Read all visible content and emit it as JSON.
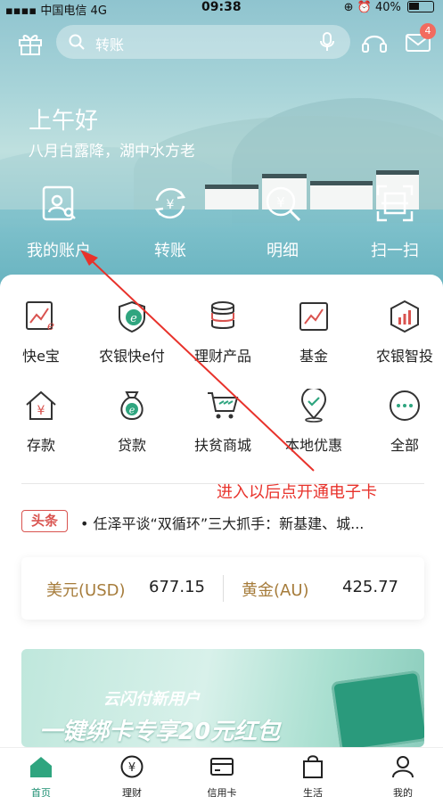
{
  "status_bar": {
    "carrier": "中国电信",
    "network": "4G",
    "time": "09:38",
    "battery": "40%"
  },
  "search": {
    "placeholder": "转账"
  },
  "notifications": {
    "mail_count": "4"
  },
  "greeting": {
    "title": "上午好",
    "subtitle": "八月白露降，湖中水方老"
  },
  "quick_actions": [
    {
      "label": "我的账户",
      "icon": "account-icon"
    },
    {
      "label": "转账",
      "icon": "transfer-icon"
    },
    {
      "label": "明细",
      "icon": "details-icon"
    },
    {
      "label": "扫一扫",
      "icon": "scan-icon"
    }
  ],
  "services_row1": [
    {
      "label": "快e宝",
      "icon": "kuaie-bao-icon"
    },
    {
      "label": "农银快e付",
      "icon": "kuaie-pay-icon"
    },
    {
      "label": "理财产品",
      "icon": "wealth-product-icon"
    },
    {
      "label": "基金",
      "icon": "fund-icon"
    },
    {
      "label": "农银智投",
      "icon": "smart-invest-icon"
    }
  ],
  "services_row2": [
    {
      "label": "存款",
      "icon": "deposit-icon"
    },
    {
      "label": "贷款",
      "icon": "loan-icon"
    },
    {
      "label": "扶贫商城",
      "icon": "poverty-mall-icon"
    },
    {
      "label": "本地优惠",
      "icon": "local-offers-icon"
    },
    {
      "label": "全部",
      "icon": "all-icon"
    }
  ],
  "annotation": "进入以后点开通电子卡",
  "news": {
    "tag": "头条",
    "text": "• 任泽平谈“双循环”三大抓手：新基建、城..."
  },
  "rates": {
    "usd_label": "美元(USD)",
    "usd_value": "677.15",
    "gold_label": "黄金(AU)",
    "gold_value": "425.77"
  },
  "banner": {
    "line1": "云闪付新用户",
    "line2": "一键绑卡专享20元红包"
  },
  "tabs": [
    {
      "label": "首页",
      "icon": "home-icon",
      "active": true
    },
    {
      "label": "理财",
      "icon": "yuan-icon",
      "active": false
    },
    {
      "label": "信用卡",
      "icon": "credit-card-icon",
      "active": false
    },
    {
      "label": "生活",
      "icon": "shopping-bag-icon",
      "active": false
    },
    {
      "label": "我的",
      "icon": "profile-icon",
      "active": false
    }
  ],
  "colors": {
    "accent": "#1d8f72",
    "annotation": "#e8322b",
    "gold": "#a67c3b"
  }
}
